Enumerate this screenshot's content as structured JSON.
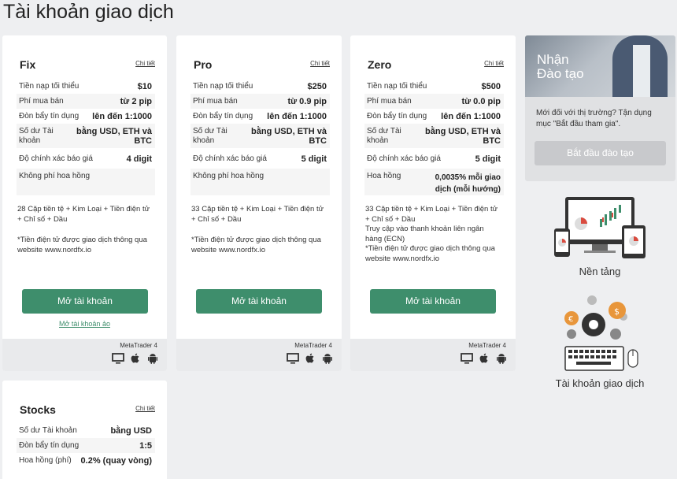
{
  "title": "Tài khoản giao dịch",
  "accounts": [
    {
      "name": "Fix",
      "detail": "Chi tiết",
      "rows": [
        {
          "k": "Tiền nạp tối thiểu",
          "v": "$10"
        },
        {
          "k": "Phí mua bán",
          "v": "từ 2 pip"
        },
        {
          "k": "Đòn bẩy tín dụng",
          "v": "lên đến 1:1000"
        },
        {
          "k": "Số dư Tài khoản",
          "v": "bằng USD, ETH và BTC"
        },
        {
          "k": "Độ chính xác báo giá",
          "v": "4 digit"
        },
        {
          "k": "Không phí hoa hồng",
          "v": ""
        }
      ],
      "desc1": "28 Cặp tiền tệ + Kim Loại + Tiền điện tử + Chỉ số + Dầu",
      "desc2": "*Tiền điện tử được giao dịch thông qua website www.nordfx.io",
      "open": "Mở tài khoản",
      "demo": "Mở tài khoản ảo",
      "platform": "MetaTrader 4"
    },
    {
      "name": "Pro",
      "detail": "Chi tiết",
      "rows": [
        {
          "k": "Tiền nạp tối thiểu",
          "v": "$250"
        },
        {
          "k": "Phí mua bán",
          "v": "từ 0.9 pip"
        },
        {
          "k": "Đòn bẩy tín dụng",
          "v": "lên đến 1:1000"
        },
        {
          "k": "Số dư Tài khoản",
          "v": "bằng USD, ETH và BTC"
        },
        {
          "k": "Độ chính xác báo giá",
          "v": "5 digit"
        },
        {
          "k": "Không phí hoa hồng",
          "v": ""
        }
      ],
      "desc1": "33 Cặp tiền tệ + Kim Loại + Tiền điện tử + Chỉ số + Dầu",
      "desc2": "*Tiền điện tử được giao dịch thông qua website www.nordfx.io",
      "open": "Mở tài khoản",
      "platform": "MetaTrader 4"
    },
    {
      "name": "Zero",
      "detail": "Chi tiết",
      "rows": [
        {
          "k": "Tiền nạp tối thiểu",
          "v": "$500"
        },
        {
          "k": "Phí mua bán",
          "v": "từ 0.0 pip"
        },
        {
          "k": "Đòn bẩy tín dụng",
          "v": "lên đến 1:1000"
        },
        {
          "k": "Số dư Tài khoản",
          "v": "bằng USD, ETH và BTC"
        },
        {
          "k": "Độ chính xác báo giá",
          "v": "5 digit"
        },
        {
          "k": "Hoa hồng",
          "v": "0,0035% mỗi giao dịch (mỗi hướng)"
        }
      ],
      "desc1": "33 Cặp tiền tệ + Kim Loại + Tiền điện tử + Chỉ số + Dầu",
      "desc2": "Truy cập vào thanh khoản liên ngân hàng (ECN)",
      "desc3": "*Tiền điện tử được giao dịch thông qua website www.nordfx.io",
      "open": "Mở tài khoản",
      "platform": "MetaTrader 4"
    },
    {
      "name": "Stocks",
      "detail": "Chi tiết",
      "rows": [
        {
          "k": "Số dư Tài khoản",
          "v": "bằng USD"
        },
        {
          "k": "Đòn bẩy tín dụng",
          "v": "1:5"
        },
        {
          "k": "Hoa hồng (phí)",
          "v": "0.2% (quay vòng)"
        }
      ]
    }
  ],
  "edu": {
    "title_line1": "Nhận",
    "title_line2": "Đào tạo",
    "text": "Mới đối với thị trường? Tận dụng mục \"Bắt đầu tham gia\".",
    "button": "Bắt đầu đào tạo"
  },
  "side": {
    "platforms": "Nền tảng",
    "accounts": "Tài khoản giao dịch"
  },
  "colors": {
    "accent": "#3e8e6c",
    "background": "#eeeff1",
    "footer": "#e9eaec"
  }
}
